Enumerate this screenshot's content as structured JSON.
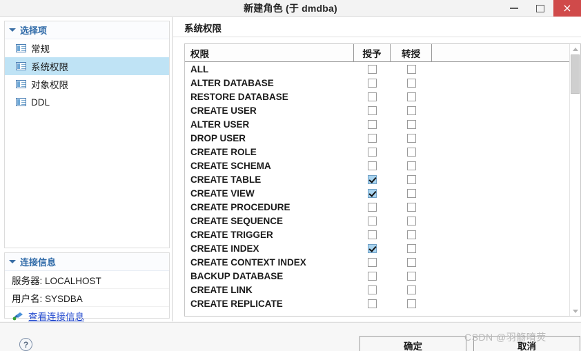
{
  "window": {
    "title": "新建角色  (于 dmdba)",
    "minimize_label": "最小化",
    "maximize_label": "最大化",
    "close_label": "×"
  },
  "sidebar": {
    "options_section": {
      "header": "选择项",
      "items": [
        {
          "label": "常规",
          "selected": false
        },
        {
          "label": "系统权限",
          "selected": true
        },
        {
          "label": "对象权限",
          "selected": false
        },
        {
          "label": "DDL",
          "selected": false
        }
      ]
    },
    "connection_section": {
      "header": "连接信息",
      "server": "服务器: LOCALHOST",
      "user": "用户名: SYSDBA",
      "view_link": "查看连接信息"
    }
  },
  "main": {
    "panel_title": "系统权限",
    "table": {
      "columns": [
        "权限",
        "授予",
        "转授"
      ],
      "rows": [
        {
          "name": "ALL",
          "grant": false,
          "transfer": false
        },
        {
          "name": "ALTER DATABASE",
          "grant": false,
          "transfer": false
        },
        {
          "name": "RESTORE DATABASE",
          "grant": false,
          "transfer": false
        },
        {
          "name": "CREATE USER",
          "grant": false,
          "transfer": false
        },
        {
          "name": "ALTER USER",
          "grant": false,
          "transfer": false
        },
        {
          "name": "DROP USER",
          "grant": false,
          "transfer": false
        },
        {
          "name": "CREATE ROLE",
          "grant": false,
          "transfer": false
        },
        {
          "name": "CREATE SCHEMA",
          "grant": false,
          "transfer": false
        },
        {
          "name": "CREATE TABLE",
          "grant": true,
          "transfer": false
        },
        {
          "name": "CREATE VIEW",
          "grant": true,
          "transfer": false
        },
        {
          "name": "CREATE PROCEDURE",
          "grant": false,
          "transfer": false
        },
        {
          "name": "CREATE SEQUENCE",
          "grant": false,
          "transfer": false
        },
        {
          "name": "CREATE TRIGGER",
          "grant": false,
          "transfer": false
        },
        {
          "name": "CREATE INDEX",
          "grant": true,
          "transfer": false
        },
        {
          "name": "CREATE CONTEXT INDEX",
          "grant": false,
          "transfer": false
        },
        {
          "name": "BACKUP DATABASE",
          "grant": false,
          "transfer": false
        },
        {
          "name": "CREATE LINK",
          "grant": false,
          "transfer": false
        },
        {
          "name": "CREATE REPLICATE",
          "grant": false,
          "transfer": false
        }
      ]
    }
  },
  "footer": {
    "help_label": "?",
    "ok_label": "确定",
    "cancel_label": "取消"
  },
  "watermark": "CSDN @羽觞唷荧",
  "colors": {
    "selection": "#bfe3f5",
    "link": "#2a4fd0",
    "section_header": "#2f6aa8",
    "close_button": "#d04a4a",
    "checkbox_checked": "#a8d4f0"
  }
}
